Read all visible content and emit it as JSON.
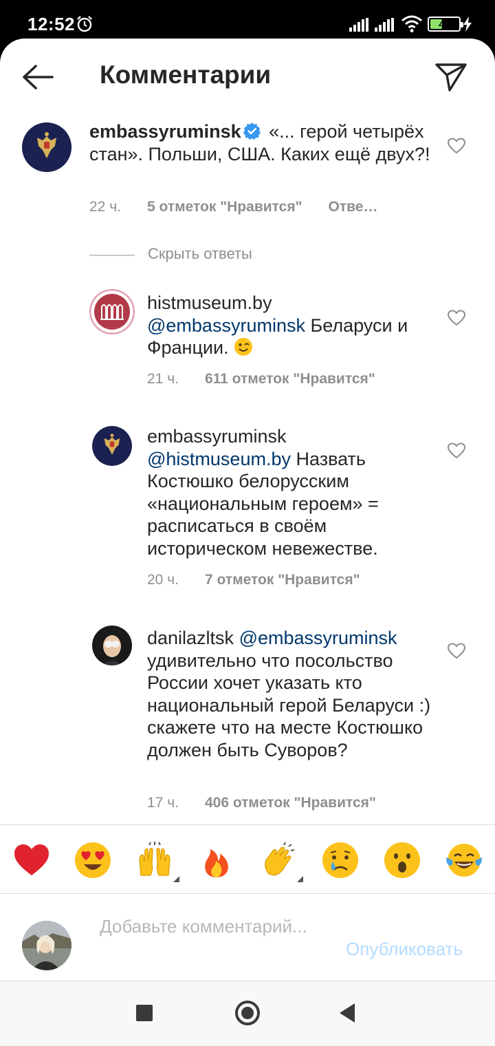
{
  "status_bar": {
    "time": "12:52",
    "battery": "47"
  },
  "header": {
    "title": "Комментарии"
  },
  "main_comment": {
    "username": "embassyruminsk",
    "text": "«... герой четырёх стан». Польши, США. Каких ещё двух?!",
    "time": "22 ч.",
    "likes": "5 отметок \"Нравится\"",
    "reply": "Отве…"
  },
  "hide_replies": "Скрыть ответы",
  "replies": [
    {
      "username": "histmuseum.by",
      "mention": "@embassyruminsk",
      "text": "Беларуси и Франции.",
      "time": "21 ч.",
      "likes": "611 отметок \"Нравится\""
    },
    {
      "username": "embassyruminsk",
      "mention": "@histmuseum.by",
      "text": "Назвать Костюшко белорусским «национальным героем» = расписаться в своём историческом невежестве.",
      "time": "20 ч.",
      "likes": "7 отметок \"Нравится\""
    },
    {
      "username": "danilazltsk",
      "mention": "@embassyruminsk",
      "text": "удивительно что посольство России хочет указать кто национальный герой Беларуси :) скажете что на месте Костюшко должен быть Суворов?",
      "time": "17 ч.",
      "likes": "406 отметок \"Нравится\""
    }
  ],
  "emoji_bar": [
    "red-heart",
    "heart-eyes",
    "raised-hands",
    "fire",
    "clapping-hands",
    "crying-face",
    "surprised-face",
    "tears-of-joy"
  ],
  "comment_input": {
    "placeholder": "Добавьте комментарий..."
  },
  "publish_label": "Опубликовать",
  "colors": {
    "link": "#00376b",
    "muted": "#8e8e8e",
    "publish_disabled": "#b3dbff",
    "verified": "#3897f0"
  }
}
